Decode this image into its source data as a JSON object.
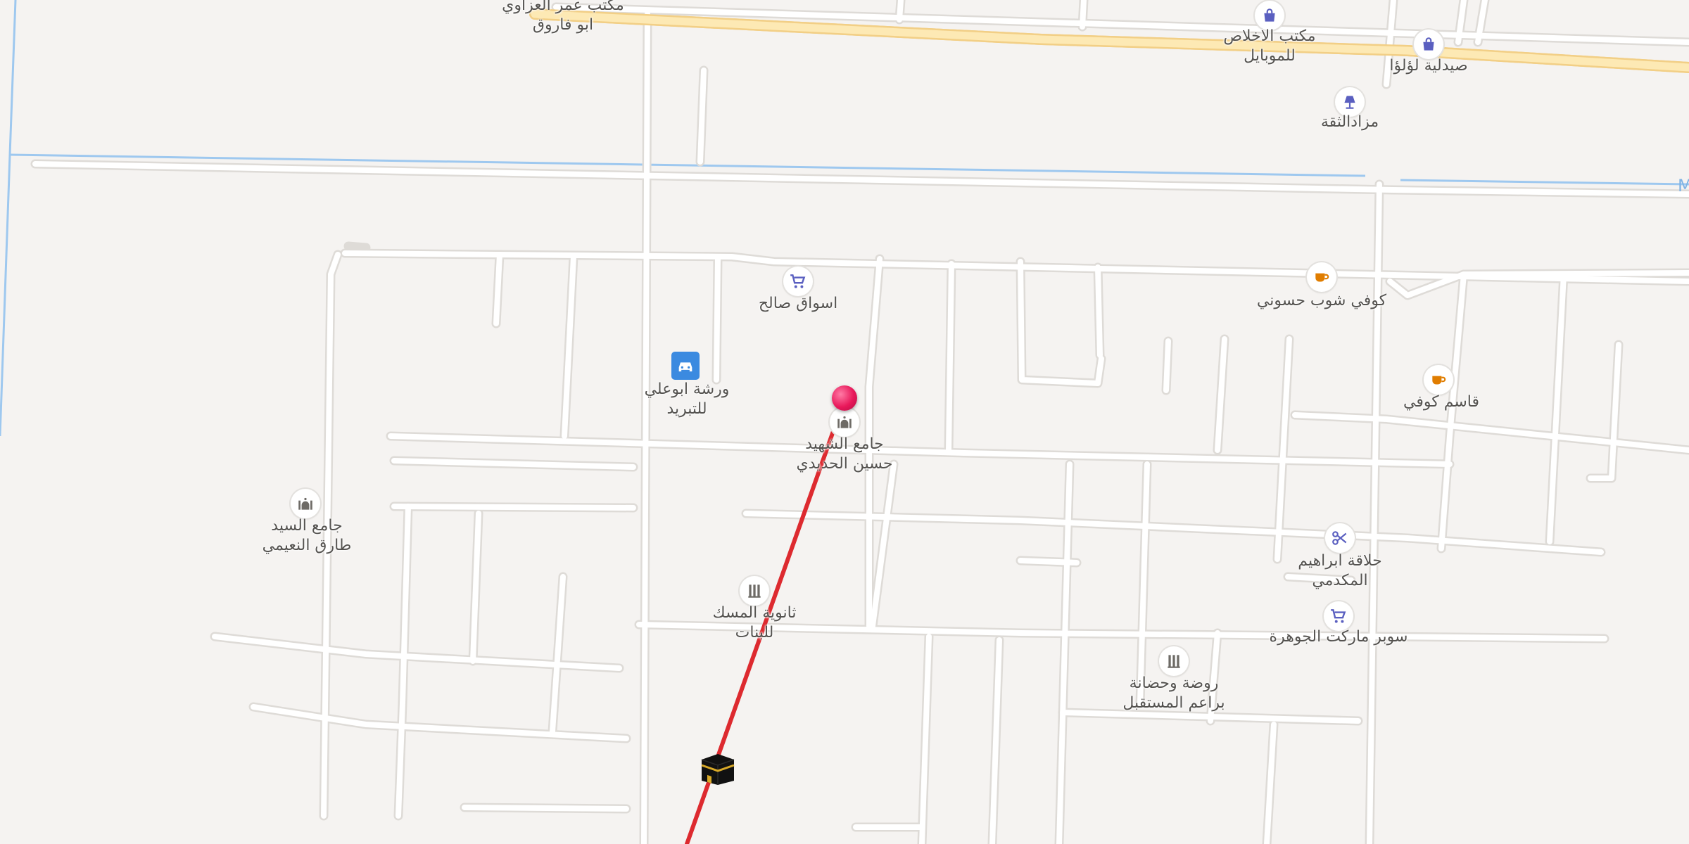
{
  "map": {
    "colors": {
      "background": "#f5f3f1",
      "street_fill": "#ffffff",
      "street_casing": "#dedbd7",
      "main_road_fill": "#fde9b4",
      "main_road_casing": "#f2cf86",
      "canal": "#9ec8ef",
      "qibla_line": "#dd2a2f",
      "pin": "#e8185a",
      "shopping_icon": "#5a5fc0",
      "cafe_icon": "#e07d00",
      "gray_icon": "#6e6b66",
      "car_badge": "#3b8ae0"
    },
    "pois": [
      {
        "id": "maktab-omar",
        "icon": "none",
        "label": "مكتب عمر العزاوي\nابو فاروق"
      },
      {
        "id": "maktab-ikhlas",
        "icon": "shopping-bag-icon",
        "label": "مكتب الاخلاص\nللموبايل"
      },
      {
        "id": "lulu-pharmacy",
        "icon": "shopping-bag-icon",
        "label": "صيدلية لؤلؤا"
      },
      {
        "id": "mazad-thiqa",
        "icon": "lamp-icon",
        "label": "مزادالثقة"
      },
      {
        "id": "aswaq-saleh",
        "icon": "cart-icon",
        "label": "اسواق صالح"
      },
      {
        "id": "coffee-hassouni",
        "icon": "coffee-cup-icon",
        "label": "كوفي شوب حسوني"
      },
      {
        "id": "workshop",
        "icon": "car-icon",
        "label": "ورشة ابوعلي\nللتبريد"
      },
      {
        "id": "qasim-coffee",
        "icon": "coffee-cup-icon",
        "label": "قاسم كوفي"
      },
      {
        "id": "mosque-shaheed",
        "icon": "mosque-icon",
        "label": "جامع الشهيد\nحسين الحديدي"
      },
      {
        "id": "mosque-sayed",
        "icon": "mosque-icon",
        "label": "جامع السيد\nطارق النعيمي"
      },
      {
        "id": "barber",
        "icon": "scissors-icon",
        "label": "حلاقة ابراهيم\nالمكدمي"
      },
      {
        "id": "school-misk",
        "icon": "school-icon",
        "label": "ثانوية المسك\nللبنات"
      },
      {
        "id": "jawhara-market",
        "icon": "cart-icon",
        "label": "سوبر ماركت الجوهرة"
      },
      {
        "id": "kindergarten",
        "icon": "school-icon",
        "label": "روضة وحضانة\nبراعم المستقبل"
      }
    ],
    "pin_icon": "location-pin-icon",
    "kaaba_icon": "kaaba-icon",
    "qibla_line": "qibla-direction-line",
    "edge_fragment": "M"
  }
}
